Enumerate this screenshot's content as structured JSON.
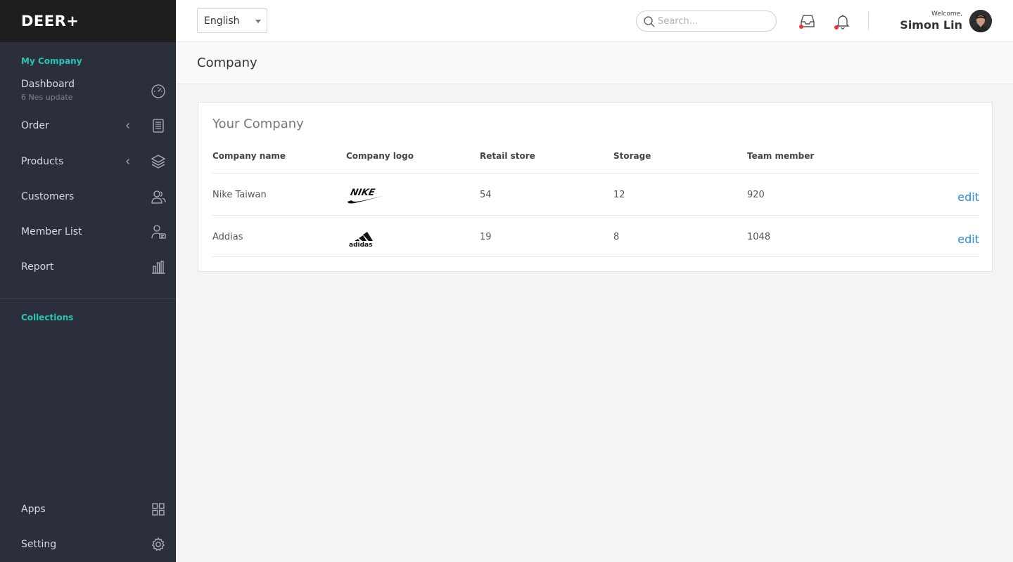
{
  "app": {
    "brand": "DEER+"
  },
  "sidebar": {
    "section_company": "My Company",
    "items": [
      {
        "label": "Dashboard",
        "sub": "6 Nes update"
      },
      {
        "label": "Order"
      },
      {
        "label": "Products"
      },
      {
        "label": "Customers"
      },
      {
        "label": "Member List"
      },
      {
        "label": "Report"
      }
    ],
    "section_collections": "Collections",
    "bottom": [
      {
        "label": "Apps"
      },
      {
        "label": "Setting"
      }
    ]
  },
  "topbar": {
    "language": "English",
    "search_placeholder": "Search...",
    "welcome": "Welcome,",
    "user_name": "Simon Lin",
    "notification_color": "#e53935"
  },
  "page": {
    "title": "Company"
  },
  "card": {
    "title": "Your Company",
    "columns": [
      "Company name",
      "Company logo",
      "Retail store",
      "Storage",
      "Team member"
    ],
    "rows": [
      {
        "name": "Nike Taiwan",
        "logo": "nike-logo",
        "retail": "54",
        "storage": "12",
        "team": "920",
        "action": "edit"
      },
      {
        "name": "Addias",
        "logo": "adidas-logo",
        "logo_text": "adidas",
        "retail": "19",
        "storage": "8",
        "team": "1048",
        "action": "edit"
      }
    ]
  },
  "colors": {
    "accent": "#27c7b3",
    "link": "#2b8ad4",
    "sidebar_bg": "#2b2f3b"
  }
}
